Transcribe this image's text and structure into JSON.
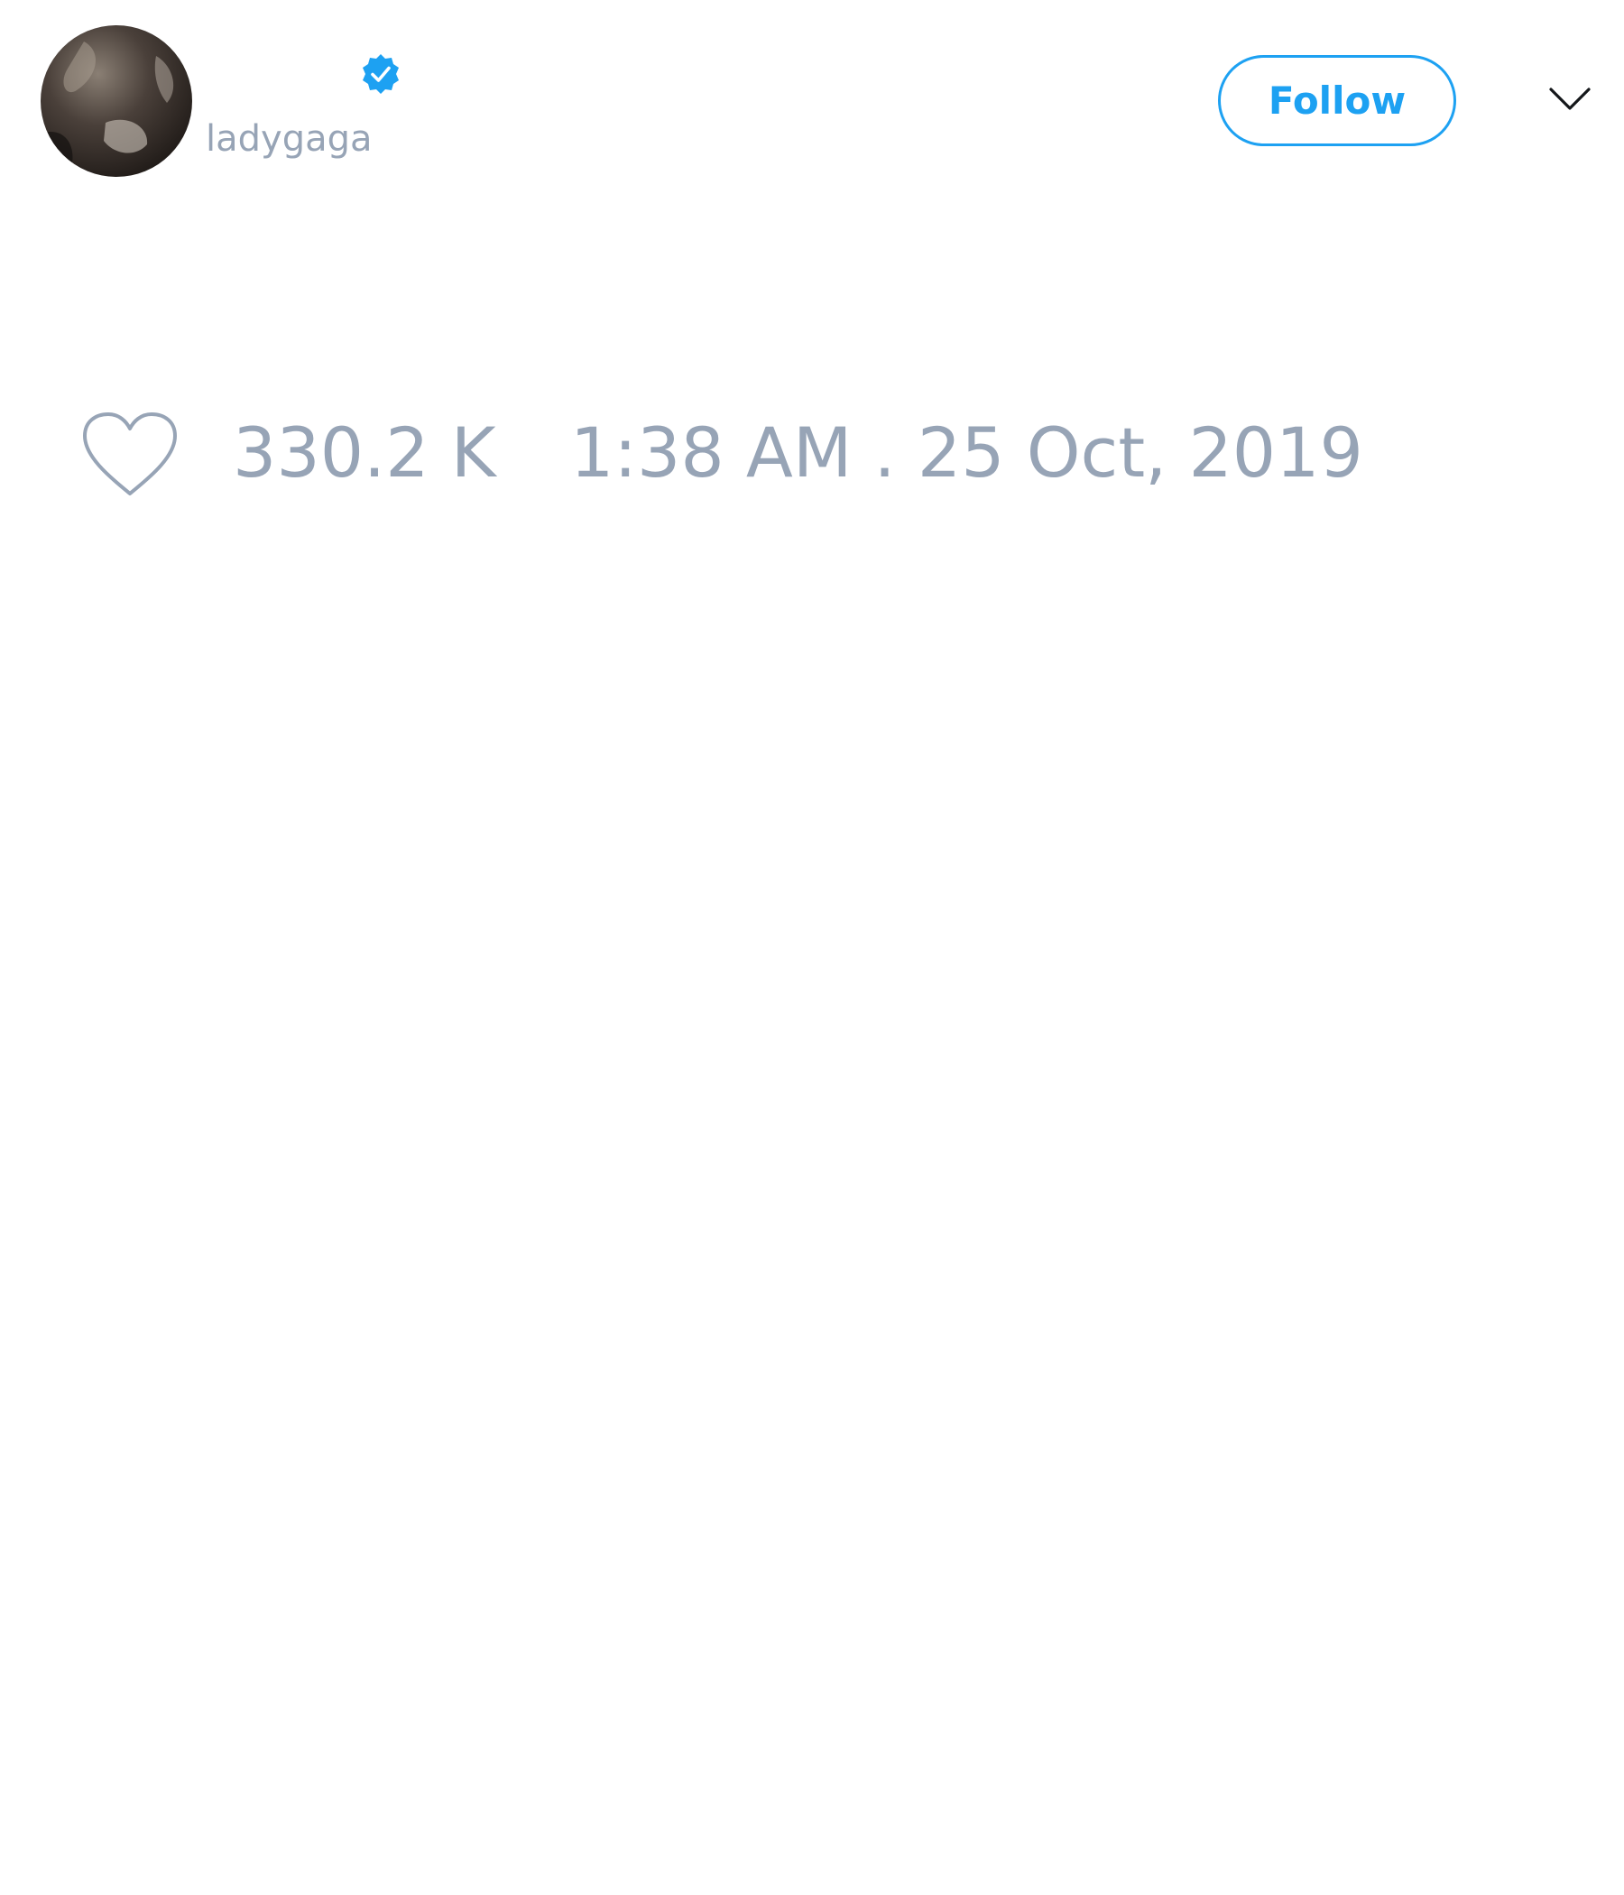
{
  "profile": {
    "username": "ladygaga",
    "avatar_icon": "profile-photo",
    "verified_icon": "verified-badge-icon"
  },
  "header": {
    "follow_label": "Follow",
    "menu_icon": "chevron-down-icon"
  },
  "stats": {
    "like_icon": "heart-icon",
    "likes": "330.2 K",
    "timestamp": "1:38 AM . 25 Oct, 2019"
  },
  "colors": {
    "accent": "#1da1f2",
    "muted_text": "#97a4b6",
    "background": "#ffffff"
  }
}
